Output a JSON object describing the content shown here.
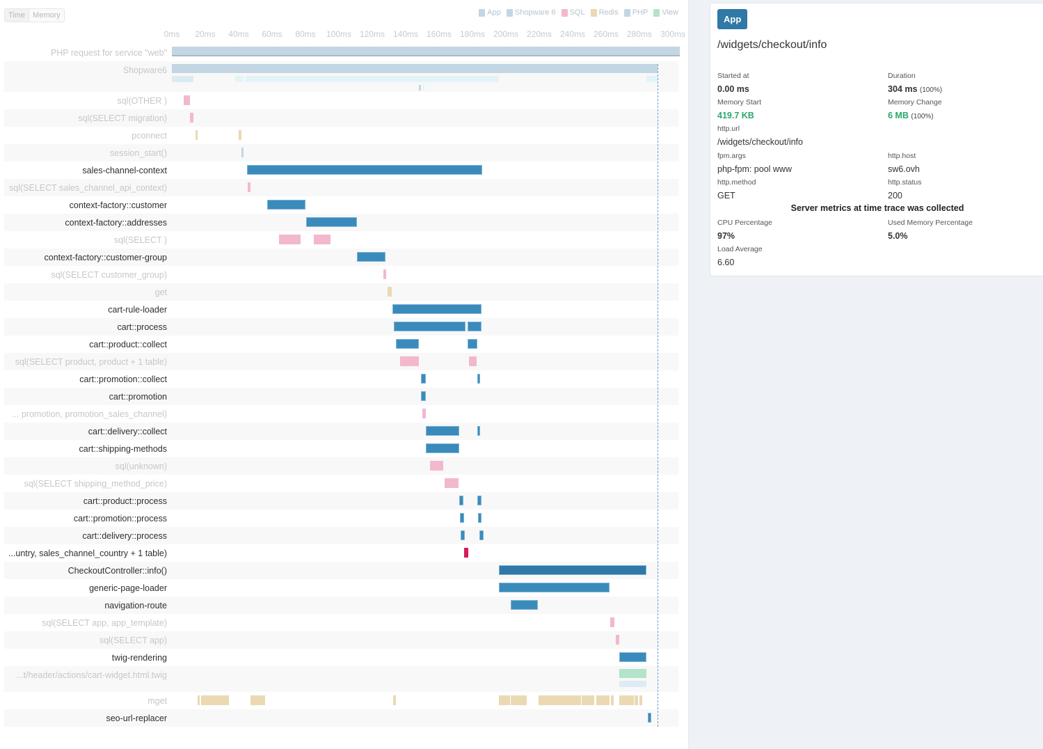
{
  "toggle": {
    "time_label": "Time",
    "memory_label": "Memory",
    "selected": "Time"
  },
  "legend": [
    {
      "label": "App",
      "color": "#c2d6e4"
    },
    {
      "label": "Shopware 6",
      "color": "#c2d6e4"
    },
    {
      "label": "SQL",
      "color": "#f2b8cd"
    },
    {
      "label": "Redis",
      "color": "#ead9b2"
    },
    {
      "label": "PHP",
      "color": "#c2d6e4"
    },
    {
      "label": "View",
      "color": "#b2e3cb"
    }
  ],
  "colors": {
    "app": "#3a8bbb",
    "app_dark": "#2f78a7",
    "php": "#c2d6e4",
    "shopware_child": "#dceaf2",
    "shopware_child2": "#e3f4f8",
    "sql": "#f2b8cd",
    "sql_hot": "#d81b5a",
    "redis": "#ead9b2",
    "view": "#b2e3cb",
    "view_light": "#deebf4"
  },
  "chart_data": {
    "type": "gantt",
    "title": "",
    "xlabel": "",
    "x_unit": "ms",
    "xlim": [
      0,
      304
    ],
    "x_ticks": [
      "0ms",
      "20ms",
      "40ms",
      "60ms",
      "80ms",
      "100ms",
      "120ms",
      "140ms",
      "160ms",
      "180ms",
      "200ms",
      "220ms",
      "240ms",
      "260ms",
      "280ms",
      "300ms"
    ],
    "x_tick_values": [
      0,
      20,
      40,
      60,
      80,
      100,
      120,
      140,
      160,
      180,
      200,
      220,
      240,
      260,
      280,
      300
    ],
    "marker_ms": 291,
    "rows": [
      {
        "label": "PHP request for service \"web\"",
        "style": "dim",
        "spans": [
          {
            "start": 0,
            "end": 304,
            "kind": "php"
          }
        ]
      },
      {
        "label": "Shopware6",
        "style": "dim",
        "tall": true,
        "spans": [
          {
            "start": 0,
            "end": 291,
            "kind": "php"
          },
          {
            "start": 0,
            "end": 13,
            "kind": "shopware_child",
            "lane": 1
          },
          {
            "start": 38,
            "end": 43,
            "kind": "shopware_child2",
            "lane": 1
          },
          {
            "start": 44,
            "end": 196,
            "kind": "shopware_child2",
            "lane": 1
          },
          {
            "start": 284,
            "end": 291,
            "kind": "shopware_child2",
            "lane": 1
          },
          {
            "start": 148,
            "end": 149,
            "kind": "php",
            "lane": 2
          },
          {
            "start": 150.5,
            "end": 151,
            "kind": "shopware_child2",
            "lane": 2
          }
        ]
      },
      {
        "label": "sql(OTHER )",
        "style": "dim",
        "spans": [
          {
            "start": 7,
            "end": 11,
            "kind": "sql"
          }
        ]
      },
      {
        "label": "sql(SELECT migration)",
        "style": "dim",
        "spans": [
          {
            "start": 11,
            "end": 13,
            "kind": "sql"
          }
        ]
      },
      {
        "label": "pconnect",
        "style": "dim",
        "spans": [
          {
            "start": 14,
            "end": 15.5,
            "kind": "redis"
          },
          {
            "start": 40,
            "end": 41.5,
            "kind": "redis"
          }
        ]
      },
      {
        "label": "session_start()",
        "style": "dim",
        "spans": [
          {
            "start": 41.5,
            "end": 43,
            "kind": "php"
          }
        ]
      },
      {
        "label": "sales-channel-context",
        "style": "main",
        "spans": [
          {
            "start": 45,
            "end": 186,
            "kind": "app"
          }
        ]
      },
      {
        "label": "sql(SELECT sales_channel_api_context)",
        "style": "dim",
        "spans": [
          {
            "start": 45.5,
            "end": 47,
            "kind": "sql"
          }
        ]
      },
      {
        "label": "context-factory::customer",
        "style": "main",
        "spans": [
          {
            "start": 57,
            "end": 80,
            "kind": "app"
          }
        ]
      },
      {
        "label": "context-factory::addresses",
        "style": "main",
        "spans": [
          {
            "start": 80.5,
            "end": 111,
            "kind": "app"
          }
        ]
      },
      {
        "label": "sql(SELECT )",
        "style": "dim",
        "spans": [
          {
            "start": 64,
            "end": 77,
            "kind": "sql"
          },
          {
            "start": 85,
            "end": 95,
            "kind": "sql"
          }
        ]
      },
      {
        "label": "context-factory::customer-group",
        "style": "main",
        "spans": [
          {
            "start": 111,
            "end": 128,
            "kind": "app"
          }
        ]
      },
      {
        "label": "sql(SELECT customer_group)",
        "style": "dim",
        "spans": [
          {
            "start": 126.5,
            "end": 128.5,
            "kind": "sql"
          }
        ]
      },
      {
        "label": "get",
        "style": "dim",
        "spans": [
          {
            "start": 129,
            "end": 131.5,
            "kind": "redis"
          }
        ]
      },
      {
        "label": "cart-rule-loader",
        "style": "main",
        "spans": [
          {
            "start": 132,
            "end": 185.5,
            "kind": "app"
          }
        ]
      },
      {
        "label": "cart::process",
        "style": "main",
        "spans": [
          {
            "start": 133,
            "end": 176,
            "kind": "app"
          },
          {
            "start": 177,
            "end": 185.5,
            "kind": "app"
          }
        ]
      },
      {
        "label": "cart::product::collect",
        "style": "main",
        "spans": [
          {
            "start": 134,
            "end": 148,
            "kind": "app"
          },
          {
            "start": 177,
            "end": 183,
            "kind": "app"
          }
        ]
      },
      {
        "label": "sql(SELECT product, product + 1 table)",
        "style": "dim",
        "spans": [
          {
            "start": 136.5,
            "end": 148,
            "kind": "sql"
          },
          {
            "start": 178,
            "end": 182.5,
            "kind": "sql"
          }
        ]
      },
      {
        "label": "cart::promotion::collect",
        "style": "main",
        "spans": [
          {
            "start": 149,
            "end": 152,
            "kind": "app"
          },
          {
            "start": 183,
            "end": 184.5,
            "kind": "app"
          }
        ]
      },
      {
        "label": "cart::promotion",
        "style": "main",
        "spans": [
          {
            "start": 149,
            "end": 152,
            "kind": "app"
          }
        ]
      },
      {
        "label": "... promotion, promotion_sales_channel)",
        "style": "dim",
        "spans": [
          {
            "start": 150,
            "end": 152,
            "kind": "sql"
          }
        ]
      },
      {
        "label": "cart::delivery::collect",
        "style": "main",
        "spans": [
          {
            "start": 152,
            "end": 172,
            "kind": "app"
          },
          {
            "start": 183,
            "end": 184.5,
            "kind": "app"
          }
        ]
      },
      {
        "label": "cart::shipping-methods",
        "style": "main",
        "spans": [
          {
            "start": 152,
            "end": 172,
            "kind": "app"
          }
        ]
      },
      {
        "label": "sql(unknown)",
        "style": "dim",
        "spans": [
          {
            "start": 154.5,
            "end": 162.5,
            "kind": "sql"
          }
        ]
      },
      {
        "label": "sql(SELECT shipping_method_price)",
        "style": "dim",
        "spans": [
          {
            "start": 163.5,
            "end": 171.5,
            "kind": "sql"
          }
        ]
      },
      {
        "label": "cart::product::process",
        "style": "main",
        "spans": [
          {
            "start": 172,
            "end": 174.5,
            "kind": "app"
          },
          {
            "start": 183,
            "end": 185.5,
            "kind": "app"
          }
        ]
      },
      {
        "label": "cart::promotion::process",
        "style": "main",
        "spans": [
          {
            "start": 172.5,
            "end": 175,
            "kind": "app"
          },
          {
            "start": 183.5,
            "end": 185.5,
            "kind": "app"
          }
        ]
      },
      {
        "label": "cart::delivery::process",
        "style": "main",
        "spans": [
          {
            "start": 173,
            "end": 175.5,
            "kind": "app"
          },
          {
            "start": 184,
            "end": 186.5,
            "kind": "app"
          }
        ]
      },
      {
        "label": "...untry, sales_channel_country + 1 table)",
        "style": "main",
        "spans": [
          {
            "start": 175,
            "end": 177.5,
            "kind": "sql_hot"
          }
        ]
      },
      {
        "label": "CheckoutController::info()",
        "style": "main",
        "spans": [
          {
            "start": 196,
            "end": 284,
            "kind": "app_dark"
          }
        ]
      },
      {
        "label": "generic-page-loader",
        "style": "main",
        "spans": [
          {
            "start": 196,
            "end": 262,
            "kind": "app"
          }
        ]
      },
      {
        "label": "navigation-route",
        "style": "main",
        "spans": [
          {
            "start": 203,
            "end": 219,
            "kind": "app"
          }
        ]
      },
      {
        "label": "sql(SELECT app, app_template)",
        "style": "dim",
        "spans": [
          {
            "start": 262.5,
            "end": 265,
            "kind": "sql"
          }
        ]
      },
      {
        "label": "sql(SELECT app)",
        "style": "dim",
        "spans": [
          {
            "start": 266,
            "end": 268,
            "kind": "sql"
          }
        ]
      },
      {
        "label": "twig-rendering",
        "style": "main",
        "spans": [
          {
            "start": 268,
            "end": 284,
            "kind": "app"
          }
        ]
      },
      {
        "label": "...t/header/actions/cart-widget.html.twig",
        "style": "dim",
        "tall": true,
        "spans": [
          {
            "start": 268,
            "end": 284,
            "kind": "view"
          },
          {
            "start": 268,
            "end": 284,
            "kind": "view_light",
            "lane": 1
          }
        ]
      },
      {
        "label": "mget",
        "style": "dim",
        "spans": [
          {
            "start": 15.5,
            "end": 16.5,
            "kind": "redis"
          },
          {
            "start": 17.5,
            "end": 34,
            "kind": "redis"
          },
          {
            "start": 47,
            "end": 56,
            "kind": "redis"
          },
          {
            "start": 132.5,
            "end": 134,
            "kind": "redis"
          },
          {
            "start": 196,
            "end": 202.5,
            "kind": "redis"
          },
          {
            "start": 203,
            "end": 212.5,
            "kind": "redis"
          },
          {
            "start": 219.5,
            "end": 245,
            "kind": "redis"
          },
          {
            "start": 245.5,
            "end": 253,
            "kind": "redis"
          },
          {
            "start": 254,
            "end": 262,
            "kind": "redis"
          },
          {
            "start": 263,
            "end": 264.5,
            "kind": "redis"
          },
          {
            "start": 268,
            "end": 276.5,
            "kind": "redis"
          },
          {
            "start": 277,
            "end": 279,
            "kind": "redis"
          },
          {
            "start": 280,
            "end": 281.5,
            "kind": "redis"
          }
        ]
      },
      {
        "label": "seo-url-replacer",
        "style": "main",
        "spans": [
          {
            "start": 285,
            "end": 287,
            "kind": "app"
          }
        ]
      }
    ]
  },
  "detail": {
    "badge": "App",
    "title": "/widgets/checkout/info",
    "started_at_label": "Started at",
    "started_at_value": "0.00 ms",
    "duration_label": "Duration",
    "duration_value": "304 ms",
    "duration_pct": "(100%)",
    "memory_start_label": "Memory Start",
    "memory_start_value": "419.7 KB",
    "memory_change_label": "Memory Change",
    "memory_change_value": "6 MB",
    "memory_change_pct": "(100%)",
    "http_url_label": "http.url",
    "http_url_value": "/widgets/checkout/info",
    "fpm_args_label": "fpm.args",
    "fpm_args_value": "php-fpm: pool www",
    "http_host_label": "http.host",
    "http_host_value": "sw6.ovh",
    "http_method_label": "http.method",
    "http_method_value": "GET",
    "http_status_label": "http.status",
    "http_status_value": "200",
    "metrics_heading": "Server metrics at time trace was collected",
    "cpu_label": "CPU Percentage",
    "cpu_value": "97%",
    "used_mem_label": "Used Memory Percentage",
    "used_mem_value": "5.0%",
    "load_label": "Load Average",
    "load_value": "6.60"
  }
}
